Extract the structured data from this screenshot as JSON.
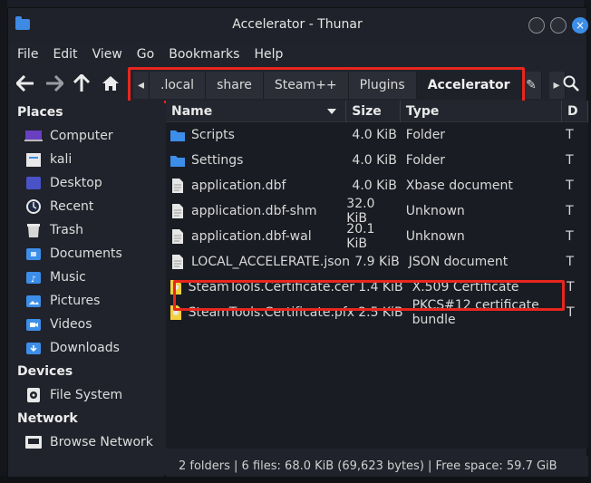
{
  "window": {
    "title": "Accelerator - Thunar",
    "close_glyph": "×"
  },
  "menu": [
    "File",
    "Edit",
    "View",
    "Go",
    "Bookmarks",
    "Help"
  ],
  "toolbar": {
    "path": [
      ".local",
      "share",
      "Steam++",
      "Plugins",
      "Accelerator"
    ],
    "active_segment": "Accelerator",
    "left_arrow": "◂",
    "right_arrow": "▸",
    "overflow_glyph": "✎"
  },
  "sidebar": {
    "places_title": "Places",
    "places": [
      {
        "label": "Computer",
        "icon": "computer-icon"
      },
      {
        "label": "kali",
        "icon": "home-folder-icon"
      },
      {
        "label": "Desktop",
        "icon": "desktop-icon"
      },
      {
        "label": "Recent",
        "icon": "recent-icon"
      },
      {
        "label": "Trash",
        "icon": "trash-icon"
      },
      {
        "label": "Documents",
        "icon": "documents-icon"
      },
      {
        "label": "Music",
        "icon": "music-icon"
      },
      {
        "label": "Pictures",
        "icon": "pictures-icon"
      },
      {
        "label": "Videos",
        "icon": "videos-icon"
      },
      {
        "label": "Downloads",
        "icon": "downloads-icon"
      }
    ],
    "devices_title": "Devices",
    "devices": [
      {
        "label": "File System",
        "icon": "drive-icon"
      }
    ],
    "network_title": "Network",
    "network": [
      {
        "label": "Browse Network",
        "icon": "network-icon"
      }
    ]
  },
  "files": {
    "columns": {
      "name": "Name",
      "size": "Size",
      "type": "Type",
      "date": "D"
    },
    "rows": [
      {
        "name": "Scripts",
        "size": "4.0 KiB",
        "type": "Folder",
        "date": "T",
        "icon": "folder-icon"
      },
      {
        "name": "Settings",
        "size": "4.0 KiB",
        "type": "Folder",
        "date": "T",
        "icon": "folder-icon"
      },
      {
        "name": "application.dbf",
        "size": "4.0 KiB",
        "type": "Xbase document",
        "date": "T",
        "icon": "file-icon"
      },
      {
        "name": "application.dbf-shm",
        "size": "32.0 KiB",
        "type": "Unknown",
        "date": "T",
        "icon": "file-icon"
      },
      {
        "name": "application.dbf-wal",
        "size": "20.1 KiB",
        "type": "Unknown",
        "date": "T",
        "icon": "file-icon"
      },
      {
        "name": "LOCAL_ACCELERATE.json",
        "size": "7.9 KiB",
        "type": "JSON document",
        "date": "T",
        "icon": "file-icon"
      },
      {
        "name": "SteamTools.Certificate.cer",
        "size": "1.4 KiB",
        "type": "X.509 Certificate",
        "date": "T",
        "icon": "certificate-icon"
      },
      {
        "name": "SteamTools.Certificate.pfx",
        "size": "2.5 KiB",
        "type": "PKCS#12 certificate bundle",
        "date": "T",
        "icon": "certificate-icon"
      }
    ]
  },
  "status": "2 folders | 6 files: 68.0 KiB (69,623 bytes) | Free space: 59.7 GiB",
  "colors": {
    "highlight": "#e8261d",
    "accent": "#3d8ee9",
    "certificate": "#f4d03f"
  }
}
